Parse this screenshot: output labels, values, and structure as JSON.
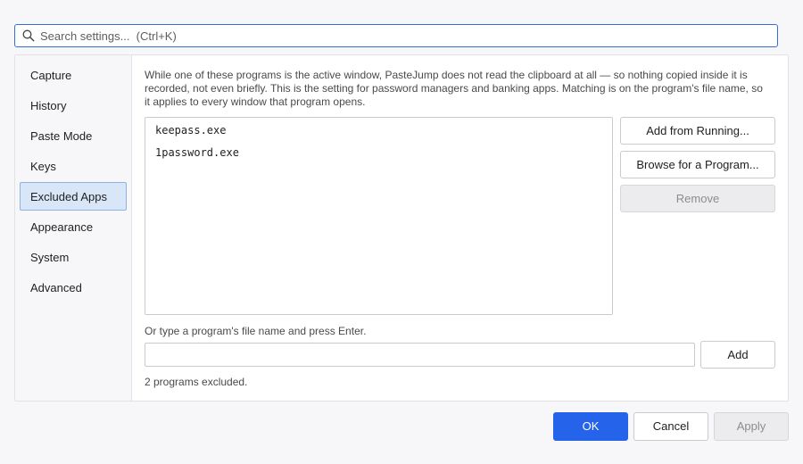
{
  "search": {
    "placeholder": "Search settings...  (Ctrl+K)",
    "icon": "search-icon"
  },
  "sidebar": {
    "items": [
      {
        "label": "Capture",
        "active": false
      },
      {
        "label": "History",
        "active": false
      },
      {
        "label": "Paste Mode",
        "active": false
      },
      {
        "label": "Keys",
        "active": false
      },
      {
        "label": "Excluded Apps",
        "active": true
      },
      {
        "label": "Appearance",
        "active": false
      },
      {
        "label": "System",
        "active": false
      },
      {
        "label": "Advanced",
        "active": false
      }
    ]
  },
  "excluded": {
    "description": "While one of these programs is the active window, PasteJump does not read the clipboard at all — so nothing copied inside it is recorded, not even briefly. This is the setting for password managers and banking apps. Matching is on the program's file name, so it applies to every window that program opens.",
    "programs": [
      "keepass.exe",
      "1password.exe"
    ],
    "add_running_label": "Add from Running...",
    "browse_label": "Browse for a Program...",
    "remove_label": "Remove",
    "hint": "Or type a program's file name and press Enter.",
    "input_value": "",
    "add_label": "Add",
    "count_text": "2 programs excluded."
  },
  "footer": {
    "ok_label": "OK",
    "cancel_label": "Cancel",
    "apply_label": "Apply"
  },
  "colors": {
    "accent": "#2563eb",
    "selected_bg": "#d9e6f7",
    "selected_border": "#8fb3e0"
  }
}
